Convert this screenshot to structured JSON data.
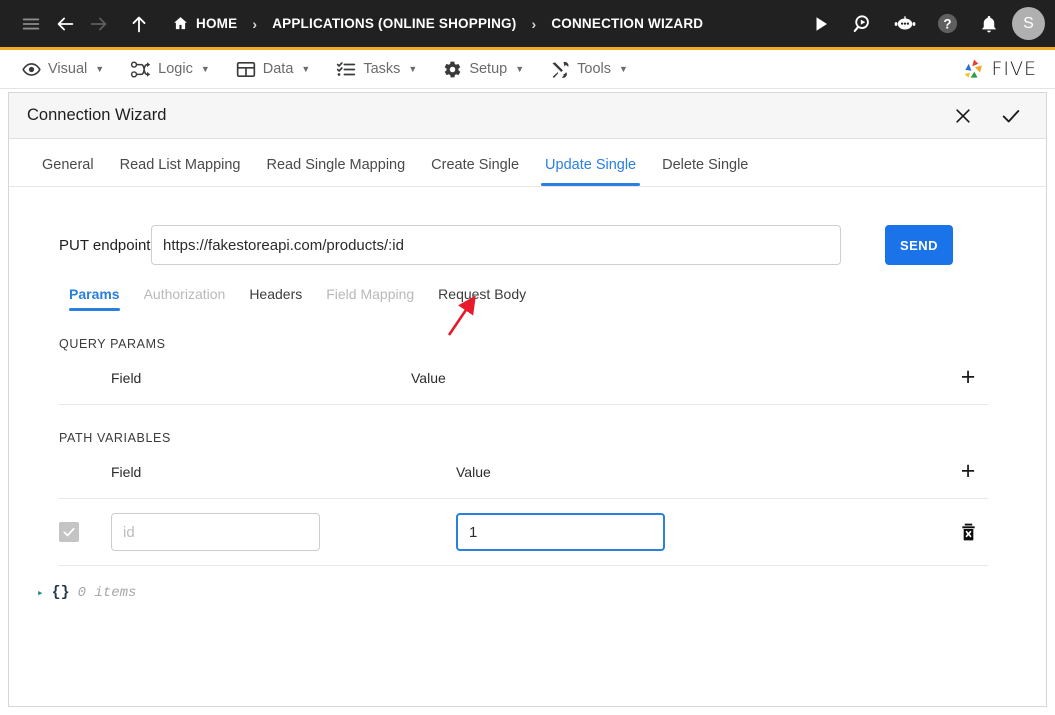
{
  "topbar": {
    "menu_icon": "hamburger-icon",
    "back_icon": "arrow-left-icon",
    "forward_icon": "arrow-right-icon",
    "up_icon": "arrow-up-icon",
    "home_icon": "home-icon",
    "breadcrumb": [
      {
        "label": "HOME",
        "icon": "home-icon"
      },
      {
        "label": "APPLICATIONS (ONLINE SHOPPING)",
        "icon": ""
      },
      {
        "label": "CONNECTION WIZARD",
        "icon": ""
      }
    ],
    "separator": "›",
    "actions": [
      {
        "name": "run-icon",
        "glyph": "▶"
      },
      {
        "name": "search-run-icon",
        "glyph": ""
      },
      {
        "name": "chatbot-icon",
        "glyph": ""
      },
      {
        "name": "help-icon",
        "glyph": "?"
      },
      {
        "name": "notifications-bell-icon",
        "glyph": ""
      }
    ],
    "avatar_initial": "S",
    "accent_underline": "#f0ab20",
    "background": "#212121"
  },
  "menubar": {
    "items": [
      {
        "label": "Visual",
        "icon": "eye-icon"
      },
      {
        "label": "Logic",
        "icon": "flow-nodes-icon"
      },
      {
        "label": "Data",
        "icon": "table-grid-icon"
      },
      {
        "label": "Tasks",
        "icon": "checklist-icon"
      },
      {
        "label": "Setup",
        "icon": "gear-icon"
      },
      {
        "label": "Tools",
        "icon": "tools-icon"
      }
    ],
    "caret": "▼",
    "logo_text": "FIVE"
  },
  "panel": {
    "title": "Connection Wizard",
    "close_label": "✕",
    "confirm_label": "✓",
    "tabs": [
      {
        "label": "General",
        "active": false
      },
      {
        "label": "Read List Mapping",
        "active": false
      },
      {
        "label": "Read Single Mapping",
        "active": false
      },
      {
        "label": "Create Single",
        "active": false
      },
      {
        "label": "Update Single",
        "active": true
      },
      {
        "label": "Delete Single",
        "active": false
      }
    ],
    "accent": "#2a7fe0"
  },
  "endpoint": {
    "label": "PUT endpoint",
    "value": "https://fakestoreapi.com/products/:id",
    "placeholder": "",
    "send_label": "SEND",
    "send_color": "#1a73e8"
  },
  "subtabs": [
    {
      "label": "Params",
      "state": "active"
    },
    {
      "label": "Authorization",
      "state": "disabled"
    },
    {
      "label": "Headers",
      "state": "normal"
    },
    {
      "label": "Field Mapping",
      "state": "disabled"
    },
    {
      "label": "Request Body",
      "state": "normal"
    }
  ],
  "query_params": {
    "title": "QUERY PARAMS",
    "columns": {
      "field": "Field",
      "value": "Value"
    },
    "add_label": "+",
    "rows": []
  },
  "path_variables": {
    "title": "PATH VARIABLES",
    "columns": {
      "field": "Field",
      "value": "Value"
    },
    "add_label": "+",
    "rows": [
      {
        "checked": true,
        "field_value": "",
        "field_placeholder": "id",
        "value": "1",
        "value_placeholder": "",
        "delete_icon": "trash-delete-icon"
      }
    ]
  },
  "json_viewer": {
    "toggle": "▸",
    "brace": "{}",
    "count_text": "0 items"
  },
  "annotation": {
    "arrow_color": "#e8192c",
    "points_at": "Request Body"
  }
}
